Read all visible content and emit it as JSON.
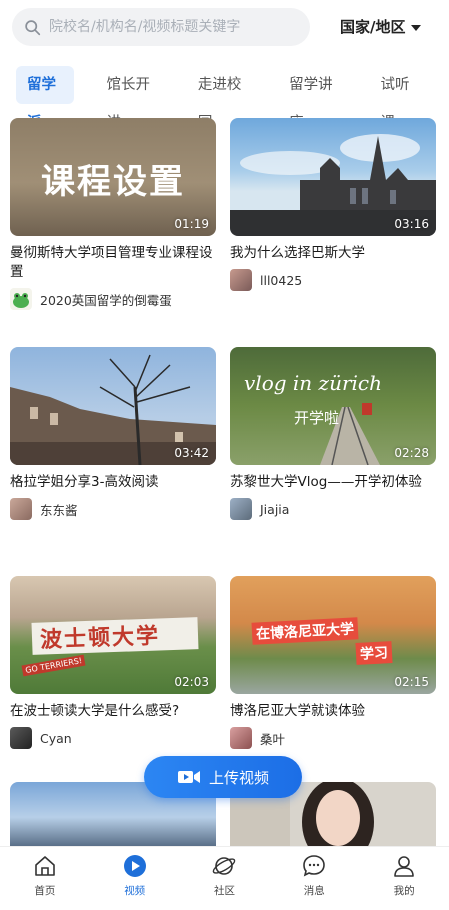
{
  "search": {
    "placeholder": "院校名/机构名/视频标题关键字"
  },
  "region": {
    "label": "国家/地区"
  },
  "tabs": [
    {
      "label": "留学派",
      "active": true
    },
    {
      "label": "馆长开讲"
    },
    {
      "label": "走进校园"
    },
    {
      "label": "留学讲座"
    },
    {
      "label": "试听课"
    }
  ],
  "cards": [
    {
      "thumb_text": "课程设置",
      "duration": "01:19",
      "title": "曼彻斯特大学项目管理专业课程设置",
      "author": "2020英国留学的倒霉蛋",
      "avatar": "frog-avatar"
    },
    {
      "duration": "03:16",
      "title": "我为什么选择巴斯大学",
      "author": "lll0425",
      "avatar": "user-avatar"
    },
    {
      "duration": "03:42",
      "title": "格拉学姐分享3-高效阅读",
      "author": "东东酱",
      "avatar": "user-avatar"
    },
    {
      "thumb_text": "vlog in zürich",
      "thumb_text2": "开学啦",
      "duration": "02:28",
      "title": "苏黎世大学Vlog——开学初体验",
      "author": "Jiajia",
      "avatar": "user-avatar"
    },
    {
      "thumb_text": "波士顿大学",
      "thumb_text2": "GO TERRIERS!",
      "duration": "02:03",
      "title": "在波士顿读大学是什么感受?",
      "author": "Cyan",
      "avatar": "user-avatar"
    },
    {
      "thumb_text": "在博洛尼亚大学",
      "thumb_text2": "学习",
      "duration": "02:15",
      "title": "博洛尼亚大学就读体验",
      "author": "桑叶",
      "avatar": "user-avatar"
    }
  ],
  "upload": {
    "label": "上传视频"
  },
  "nav": [
    {
      "label": "首页",
      "icon": "home-icon"
    },
    {
      "label": "视频",
      "icon": "video-icon",
      "active": true
    },
    {
      "label": "社区",
      "icon": "planet-icon"
    },
    {
      "label": "消息",
      "icon": "message-icon"
    },
    {
      "label": "我的",
      "icon": "profile-icon"
    }
  ],
  "colors": {
    "accent": "#1e6fd9",
    "tab_active_bg": "#e8f1fd"
  }
}
